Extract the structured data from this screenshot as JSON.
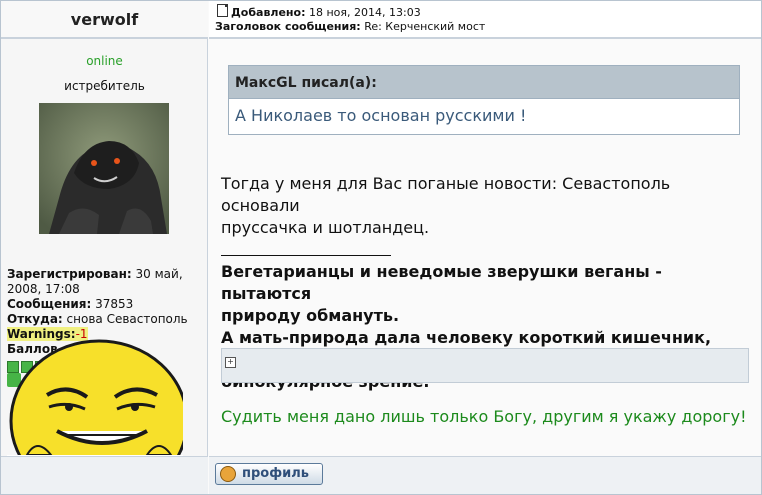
{
  "author": {
    "name": "verwolf",
    "status": "online",
    "rank": "истребитель",
    "registered_label": "Зарегистрирован:",
    "registered_value": "30 май, 2008, 17:08",
    "messages_label": "Сообщения:",
    "messages_value": "37853",
    "from_label": "Откуда:",
    "from_value": "снова Севастополь",
    "warnings_label": "Warnings:",
    "warnings_value": "-1",
    "points_label": "Баллов"
  },
  "post": {
    "added_label": "Добавлено:",
    "added_value": "18 ноя, 2014, 13:03",
    "subject_label": "Заголовок сообщения:",
    "subject_value": "Re: Керченский мост",
    "quote_author": "МаксGL писал(а):",
    "quote_text": "А Николаев то основан русскими !",
    "body_line1": "Тогда у меня для Вас поганые новости: Севастополь основали",
    "body_line2": "пруссачка и шотландец.",
    "sig_line1": "Вегетарианцы и неведомые зверушки веганы - пытаются",
    "sig_line2": "природу обмануть.",
    "sig_line3": "А мать-природа дала человеку короткий кишечник, клыки и",
    "sig_line4": "бинокулярное зрение.",
    "motto": "Судить меня дано лишь только Богу, другим я укажу дорогу!",
    "profile_button": "профиль"
  },
  "colors": {
    "online": "#2aa02a",
    "quote_text": "#3a5a7a",
    "motto": "#1c8a1c",
    "warnings_bg": "#f0f080",
    "warnings_value": "#c80000"
  },
  "icons": [
    "post-doc-icon",
    "attachment-expand-icon",
    "profile-person-icon",
    "rank-square-icon",
    "reputation-icon"
  ]
}
